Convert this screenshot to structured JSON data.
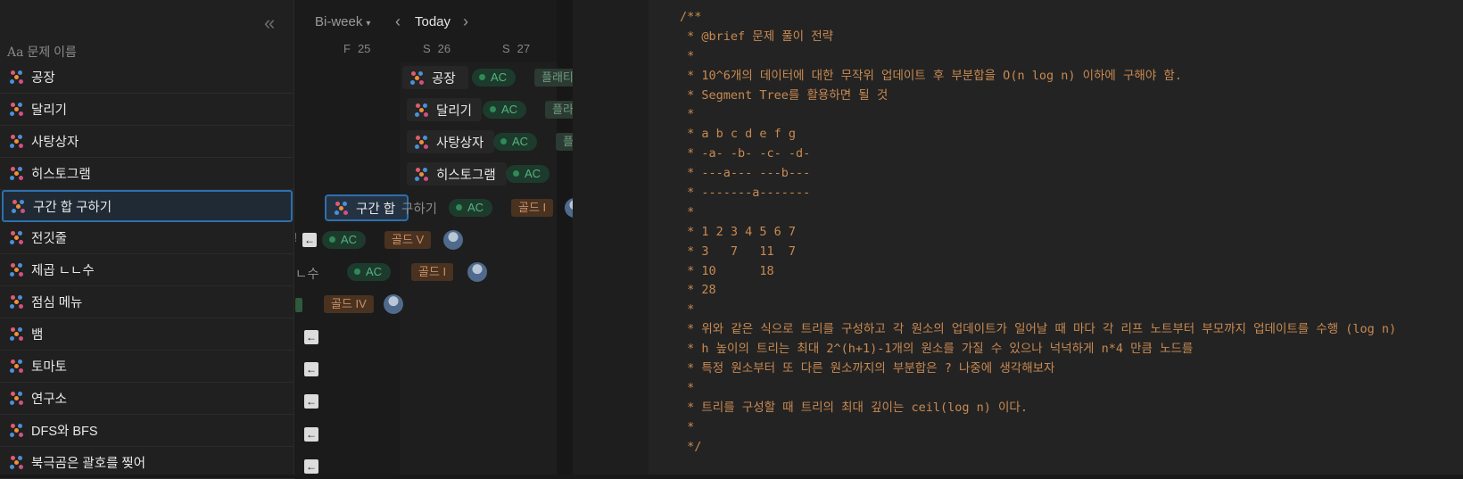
{
  "list": {
    "collapse_icon": "«",
    "column_header_icon": "Aa",
    "column_header": "문제 이름",
    "items": [
      {
        "label": "공장"
      },
      {
        "label": "달리기"
      },
      {
        "label": "사탕상자"
      },
      {
        "label": "히스토그램"
      },
      {
        "label": "구간 합 구하기",
        "selected": true
      },
      {
        "label": "전깃줄"
      },
      {
        "label": "제곱 ㄴㄴ수"
      },
      {
        "label": "점심 메뉴"
      },
      {
        "label": "뱀"
      },
      {
        "label": "토마토"
      },
      {
        "label": "연구소"
      },
      {
        "label": "DFS와 BFS"
      },
      {
        "label": "북극곰은 괄호를 찢어"
      }
    ]
  },
  "calendar": {
    "view_label": "Bi-week",
    "prev_icon": "‹",
    "today_label": "Today",
    "next_icon": "›",
    "days": [
      {
        "weekday": "F",
        "date": "25"
      },
      {
        "weekday": "S",
        "date": "26"
      },
      {
        "weekday": "S",
        "date": "27"
      }
    ],
    "cards": [
      {
        "label": "공장",
        "status": "AC",
        "tier": "플래티"
      },
      {
        "label": "달리기",
        "status": "AC",
        "tier": "플라"
      },
      {
        "label": "사탕상자",
        "status": "AC",
        "tier": "플"
      },
      {
        "label": "히스토그램",
        "status": "AC"
      },
      {
        "label": "구간 합",
        "label_rest": "구하기",
        "status": "AC",
        "tier": "골드 I"
      },
      {
        "label_fragment": "!",
        "status": "AC",
        "tier": "골드 V"
      },
      {
        "label_fragment": "ㄴ수",
        "status": "AC",
        "tier": "골드 I"
      },
      {
        "tier": "골드 IV"
      }
    ],
    "back_icon": "←"
  },
  "code": {
    "lines": [
      "/**",
      " * @brief 문제 풀이 전략",
      " *",
      " * 10^6개의 데이터에 대한 무작위 업데이트 후 부분합을 O(n log n) 이하에 구해야 함.",
      " * Segment Tree를 활용하면 될 것",
      " *",
      " * a b c d e f g",
      " * -a- -b- -c- -d-",
      " * ---a--- ---b---",
      " * -------a-------",
      " *",
      " * 1 2 3 4 5 6 7",
      " * 3   7   11  7",
      " * 10      18",
      " * 28",
      " *",
      " * 위와 같은 식으로 트리를 구성하고 각 원소의 업데이트가 일어날 때 마다 각 리프 노트부터 부모까지 업데이트를 수행 (log n)",
      " * h 높이의 트리는 최대 2^(h+1)-1개의 원소를 가질 수 있으나 넉넉하게 n*4 만큼 노드를",
      " * 특정 원소부터 또 다른 원소까지의 부분합은 ? 나중에 생각해보자",
      " *",
      " * 트리를 구성할 때 트리의 최대 깊이는 ceil(log n) 이다.",
      " *",
      " */"
    ]
  },
  "colors": {
    "background": "#191919",
    "selection": "#2e6fad",
    "status_ac": "#57b37e",
    "tier_gold": "#c9916a",
    "code_comment": "#c88a52"
  }
}
